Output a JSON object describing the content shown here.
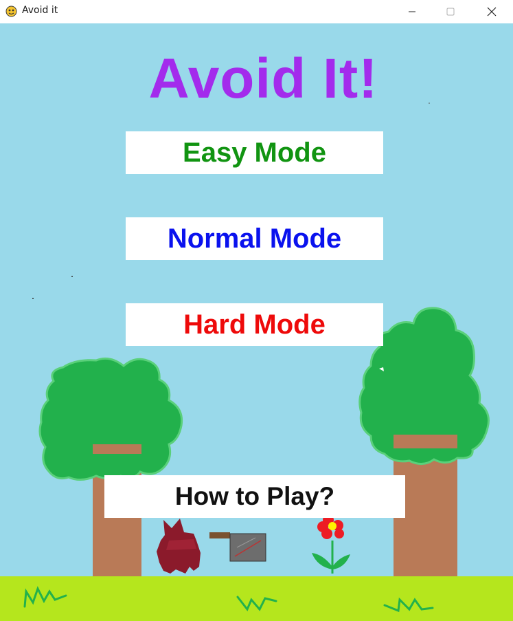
{
  "window": {
    "title": "Avoid it",
    "controls": {
      "minimize": "minimize",
      "maximize": "maximize",
      "close": "close"
    }
  },
  "game": {
    "title": "Avoid It!",
    "menu": {
      "easy": "Easy Mode",
      "normal": "Normal Mode",
      "hard": "Hard Mode",
      "how_to_play": "How to Play?"
    }
  },
  "colors": {
    "sky": "#99d9ea",
    "grass": "#b5e61d",
    "tree_leaves": "#22b14c",
    "tree_trunk": "#b97a57",
    "title": "#a32bec",
    "easy": "#119411",
    "normal": "#0a12ee",
    "hard": "#ee0a0a"
  },
  "icons": [
    "python-app-icon",
    "minimize-icon",
    "maximize-icon",
    "close-icon"
  ]
}
